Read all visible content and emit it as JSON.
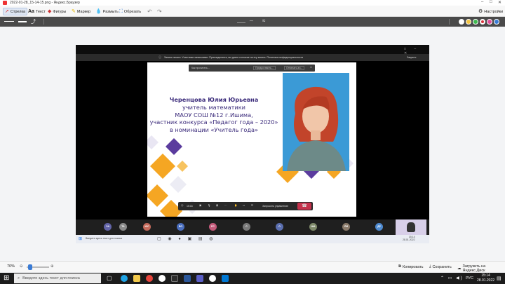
{
  "window": {
    "title": "2022-01-28_15-14-15.png - Яндекс.Браузер"
  },
  "toolbar": {
    "arrow": "Стрелка",
    "text": "Текст",
    "shapes": "Фигуры",
    "marker": "Маркер",
    "blur": "Размыть",
    "crop": "Обрезать",
    "settings": "Настройки"
  },
  "teams": {
    "notice": "Запись начата. Участники записывают. Присоединяясь, вы даете согласие на эту запись. Политика конфиденциальности",
    "notice_action": "Закрыть",
    "translation_placeholder": "Как прочитать...",
    "translation_dropdown": "Предоставить...",
    "translation_button": "Отпинать ал...",
    "timer": "15:16",
    "stop_sharing": "Запросить управление",
    "participants": [
      "ЧА",
      "ТА",
      "ЮС",
      "ВО",
      "РС",
      "С",
      "О",
      "ША",
      "ЛМ",
      "ДР"
    ],
    "task_search": "Введите здесь текст для поиска",
    "task_time": "15:14",
    "task_date": "28.01.2022"
  },
  "slide": {
    "name": "Черенцова Юлия Юрьевна",
    "line2": "учитель математики",
    "line3": "МАОУ СОШ №12 г.Ишима,",
    "line4": "участник конкурса «Педагог года – 2020»",
    "line5": "в номинации «Учитель года»"
  },
  "bottom": {
    "zoom": "70%",
    "copy": "Копировать",
    "save": "Сохранить",
    "upload": "Загрузить на Яндекс.Диск"
  },
  "taskbar": {
    "search_placeholder": "Введите здесь текст для поиска",
    "lang": "РУС",
    "time": "15:14",
    "date": "28.01.2022"
  },
  "colors": {
    "accent_orange": "#f5a623",
    "accent_purple": "#5b3c9e",
    "slide_text": "#3a2a7a",
    "end_call": "#c4314b"
  }
}
